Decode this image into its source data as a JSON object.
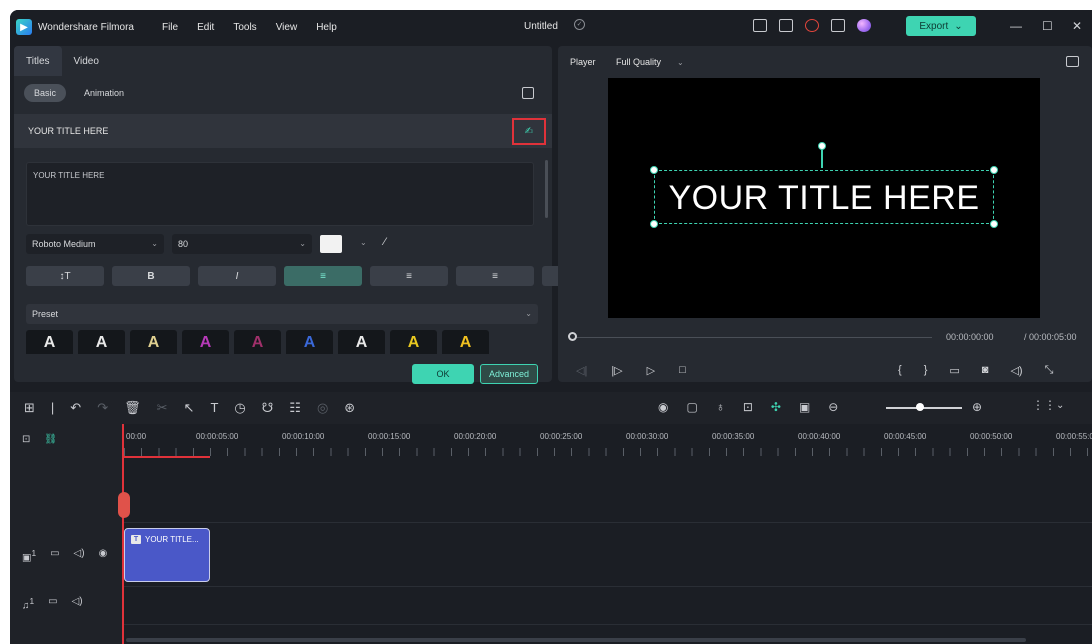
{
  "titlebar": {
    "app_name": "Wondershare Filmora",
    "menu": [
      "File",
      "Edit",
      "Tools",
      "View",
      "Help"
    ],
    "document_title": "Untitled",
    "export_label": "Export",
    "icons": [
      "layout-icon",
      "save-icon",
      "cloud-icon",
      "gift-icon",
      "avatar-icon"
    ],
    "accent": "#3ed4b2"
  },
  "left_panel": {
    "tabs": [
      "Titles",
      "Video"
    ],
    "subtabs": [
      "Basic",
      "Animation"
    ],
    "title_row_label": "YOUR TITLE HERE",
    "text_value": "YOUR TITLE HERE",
    "font_name": "Roboto Medium",
    "font_size": "80",
    "text_color": "#f2f2f2",
    "preset_label": "Preset",
    "preset_colors": [
      "#e8e8e8",
      "#e8e8e8",
      "#e0d090",
      "#b63ab8",
      "#a0306a",
      "#3a68d8",
      "#e8e8e8",
      "#e8c820",
      "#f0c020"
    ],
    "ok_label": "OK",
    "advanced_label": "Advanced"
  },
  "player": {
    "label": "Player",
    "quality": "Full Quality",
    "title_text": "YOUR TITLE HERE",
    "current_time": "00:00:00:00",
    "total_time": "/ 00:00:05:00"
  },
  "timeline": {
    "ruler_labels": [
      "00:00",
      "00:00:05:00",
      "00:00:10:00",
      "00:00:15:00",
      "00:00:20:00",
      "00:00:25:00",
      "00:00:30:00",
      "00:00:35:00",
      "00:00:40:00",
      "00:00:45:00",
      "00:00:50:00",
      "00:00:55:0"
    ],
    "clip_label": "YOUR TITLE...",
    "video_track_label": "1",
    "audio_track_label": "1",
    "clip_color": "#4a58c8"
  }
}
